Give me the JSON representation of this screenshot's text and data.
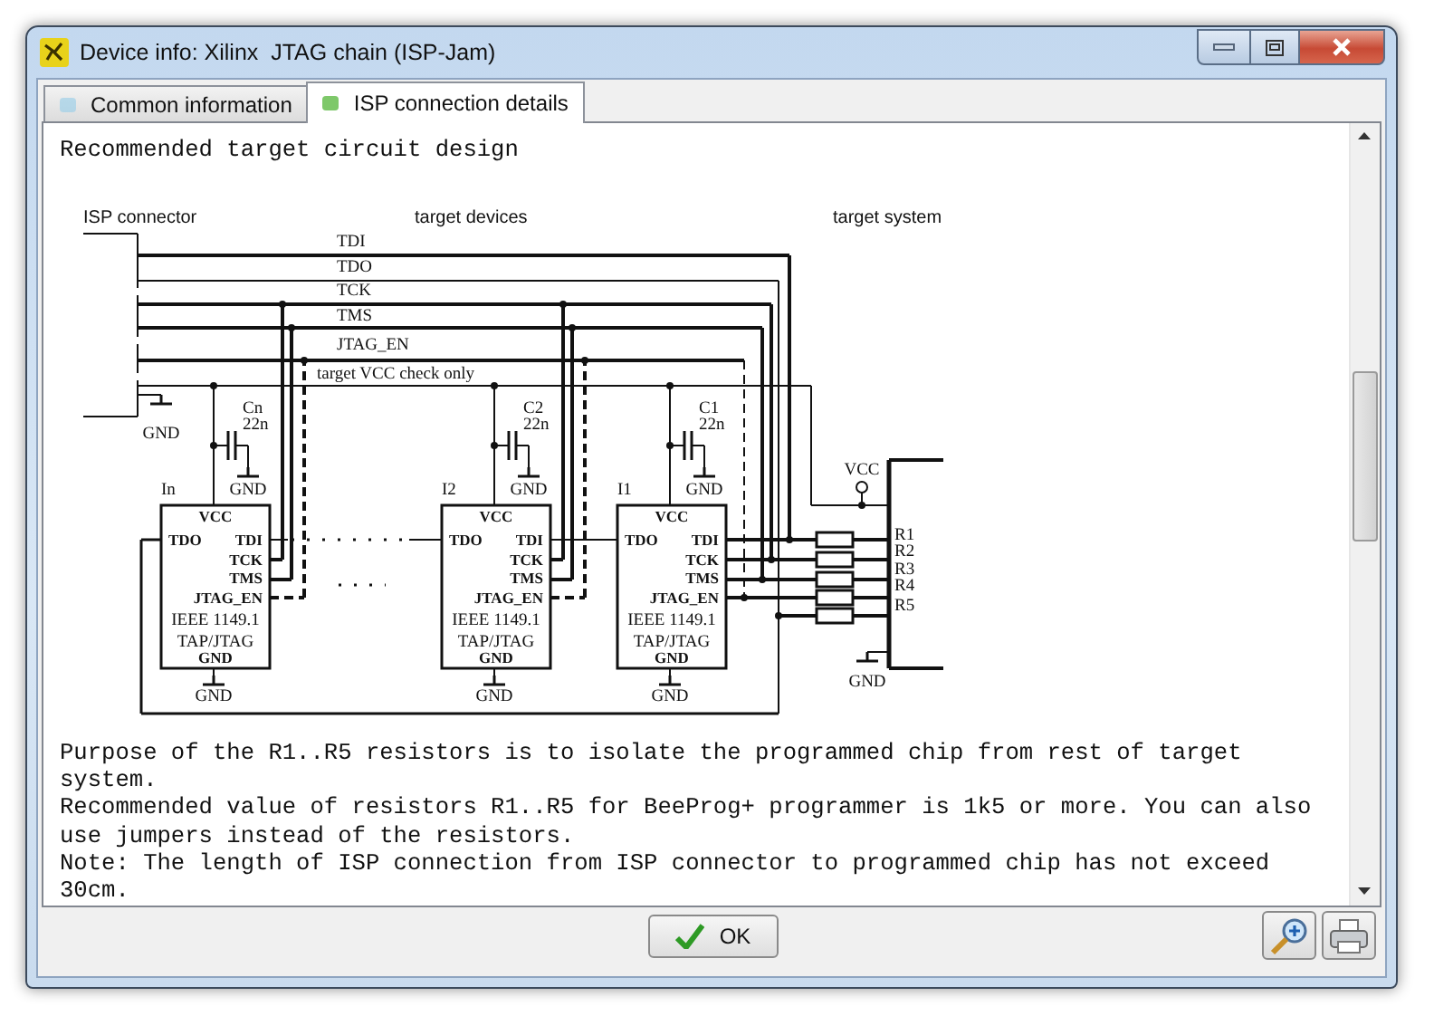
{
  "window": {
    "title": "Device info: Xilinx  JTAG chain (ISP-Jam)"
  },
  "tabs": [
    {
      "label": "Common information",
      "selected": false
    },
    {
      "label": "ISP connection details",
      "selected": true
    }
  ],
  "heading": "Recommended target circuit design",
  "diagram": {
    "section_labels": [
      "ISP connector",
      "target devices",
      "target system"
    ],
    "signals": [
      "TDI",
      "TDO",
      "TCK",
      "TMS",
      "JTAG_EN",
      "target VCC check only"
    ],
    "connector_gnd": "GND",
    "chips": [
      {
        "name": "In",
        "capacitor": "Cn",
        "capacitor_value": "22n",
        "capacitor_gnd": "GND",
        "pins": [
          "VCC",
          "TDO",
          "TDI",
          "TCK",
          "TMS",
          "JTAG_EN",
          "GND"
        ],
        "standard": "IEEE 1149.1",
        "interface": "TAP/JTAG",
        "gnd": "GND"
      },
      {
        "name": "I2",
        "capacitor": "C2",
        "capacitor_value": "22n",
        "capacitor_gnd": "GND",
        "pins": [
          "VCC",
          "TDO",
          "TDI",
          "TCK",
          "TMS",
          "JTAG_EN",
          "GND"
        ],
        "standard": "IEEE 1149.1",
        "interface": "TAP/JTAG",
        "gnd": "GND"
      },
      {
        "name": "I1",
        "capacitor": "C1",
        "capacitor_value": "22n",
        "capacitor_gnd": "GND",
        "pins": [
          "VCC",
          "TDO",
          "TDI",
          "TCK",
          "TMS",
          "JTAG_EN",
          "GND"
        ],
        "standard": "IEEE 1149.1",
        "interface": "TAP/JTAG",
        "gnd": "GND"
      }
    ],
    "target_vcc": "VCC",
    "resistors": [
      "R1",
      "R2",
      "R3",
      "R4",
      "R5"
    ],
    "target_gnd": "GND"
  },
  "notes": [
    "Purpose of the R1..R5 resistors is to isolate the programmed chip from rest of target system.",
    "Recommended value of resistors R1..R5 for BeeProg+ programmer is 1k5 or more. You can also use jumpers instead of the resistors.",
    "Note: The length of ISP connection from ISP connector to programmed chip has not exceed 30cm."
  ],
  "buttons": {
    "ok": "OK"
  }
}
